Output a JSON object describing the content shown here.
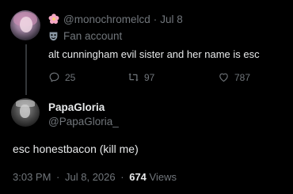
{
  "parent_tweet": {
    "handle": "@monochromelcd",
    "separator": "·",
    "date": "Jul 8",
    "account_label": "Fan account",
    "text": "alt cunningham evil sister and her name is esc",
    "reply_count": "25",
    "retweet_count": "97",
    "like_count": "787",
    "icons": {
      "flower": "flower-icon",
      "mask": "theater-mask-icon",
      "reply": "reply-icon",
      "retweet": "retweet-icon",
      "like": "heart-icon"
    }
  },
  "main_tweet": {
    "display_name": "PapaGloria",
    "handle": "@PapaGloria_",
    "text": "esc honestbacon (kill me)",
    "time": "3:03 PM",
    "separator": "·",
    "date": "Jul 8, 2026",
    "separator2": "·",
    "views_count": "674",
    "views_label": "Views"
  },
  "colors": {
    "background": "#000000",
    "primary_text": "#e7e9ea",
    "secondary_text": "#71767b",
    "flower_pink": "#f4a7c3"
  }
}
